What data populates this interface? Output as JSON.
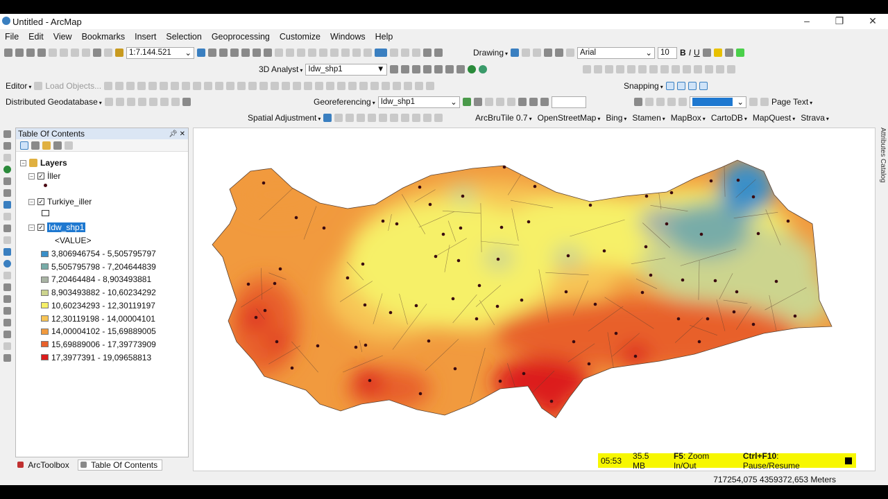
{
  "window": {
    "title": "Untitled - ArcMap"
  },
  "menu": [
    "File",
    "Edit",
    "View",
    "Bookmarks",
    "Insert",
    "Selection",
    "Geoprocessing",
    "Customize",
    "Windows",
    "Help"
  ],
  "toolbars": {
    "scale": "1:7.144.521",
    "drawing": "Drawing",
    "font": "Arial",
    "font_size": "10",
    "analyst3d": "3D Analyst",
    "analyst_layer": "Idw_shp1",
    "editor": "Editor",
    "load_objects": "Load Objects...",
    "snapping": "Snapping",
    "distributed": "Distributed Geodatabase",
    "georeferencing": "Georeferencing",
    "geo_layer": "Idw_shp1",
    "page_text": "Page Text",
    "spatial_adjustment": "Spatial Adjustment",
    "arcbrutile": [
      "ArcBruTile 0.7",
      "OpenStreetMap",
      "Bing",
      "Stamen",
      "MapBox",
      "CartoDB",
      "MapQuest",
      "Strava"
    ]
  },
  "toc": {
    "title": "Table Of Contents",
    "root": "Layers",
    "layers": [
      {
        "name": "İller",
        "checked": true
      },
      {
        "name": "Turkiye_iller",
        "checked": true
      },
      {
        "name": "Idw_shp1",
        "checked": true,
        "selected": true
      }
    ],
    "field": "<VALUE>",
    "classes": [
      {
        "label": "3,806946754 - 5,505795797",
        "color": "#3a8fc8"
      },
      {
        "label": "5,505795798 - 7,204644839",
        "color": "#78aca8"
      },
      {
        "label": "7,20464484 - 8,903493881",
        "color": "#a9b4a4"
      },
      {
        "label": "8,903493882 - 10,60234292",
        "color": "#ccd48e"
      },
      {
        "label": "10,60234293 - 12,30119197",
        "color": "#f6f068"
      },
      {
        "label": "12,30119198 - 14,00004101",
        "color": "#f7c455"
      },
      {
        "label": "14,00004102 - 15,69889005",
        "color": "#f19a3e"
      },
      {
        "label": "15,69889006 - 17,39773909",
        "color": "#e8612c"
      },
      {
        "label": "17,3977391 - 19,09658813",
        "color": "#dc1c1c"
      }
    ],
    "tabs": [
      "ArcToolbox",
      "Table Of Contents"
    ]
  },
  "side_tabs": [
    "Attributes",
    "Catalog"
  ],
  "recorder": {
    "time": "05:53",
    "size": "35.5 MB",
    "key1": "F5",
    "act1": ": Zoom In/Out",
    "key2": "Ctrl+F10",
    "act2": ": Pause/Resume"
  },
  "status": {
    "coords": "717254,075  4359372,653 Meters"
  }
}
